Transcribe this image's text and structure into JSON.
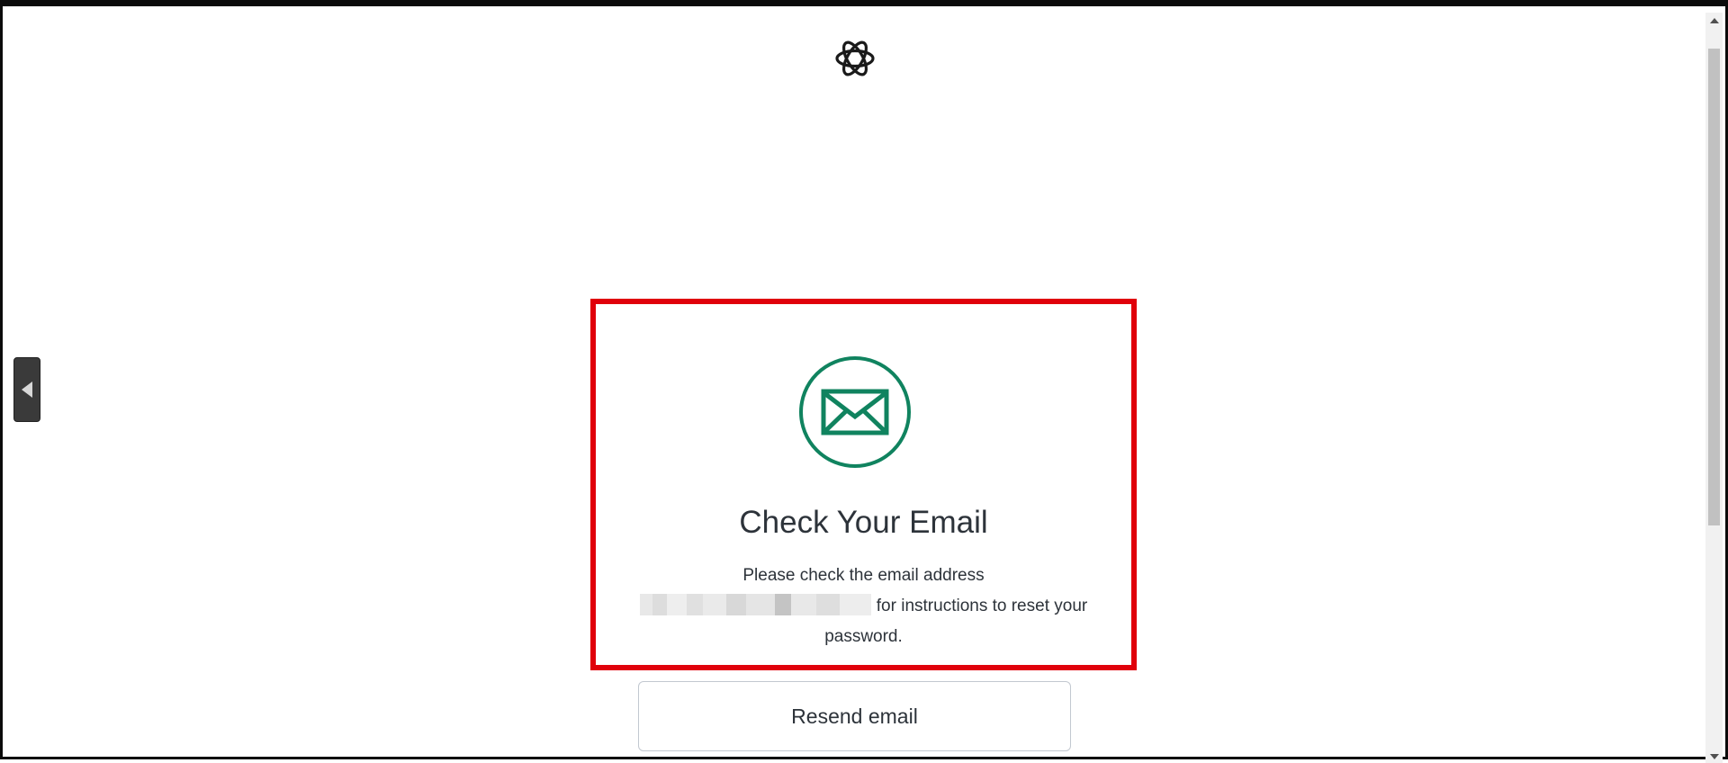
{
  "logo": {
    "icon": "openai-logo-icon"
  },
  "side_tab": {
    "icon": "triangle-left-icon"
  },
  "card": {
    "icon": "envelope-icon",
    "accent_color": "#10a37f",
    "title": "Check Your Email",
    "message_part1": "Please check the email address",
    "message_part2": "for instructions to reset your password.",
    "highlight_color": "#e0000b"
  },
  "actions": {
    "resend_label": "Resend email"
  }
}
